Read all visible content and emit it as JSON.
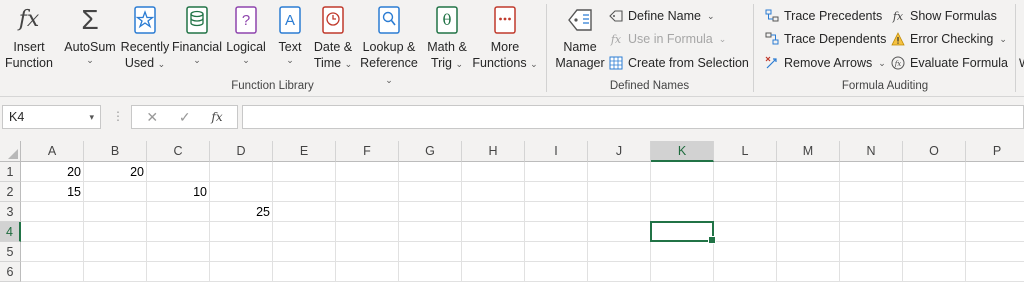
{
  "ribbon": {
    "function_library": {
      "insert_function": {
        "line1": "Insert",
        "line2": "Function",
        "icon": "fx-icon"
      },
      "autosum": {
        "line1": "AutoSum",
        "chev": "⌄",
        "icon": "sigma-icon"
      },
      "recently_used": {
        "line1": "Recently",
        "line2": "Used",
        "chev": "⌄",
        "icon": "star-book-icon"
      },
      "financial": {
        "line1": "Financial",
        "chev": "⌄",
        "icon": "coins-book-icon"
      },
      "logical": {
        "line1": "Logical",
        "chev": "⌄",
        "icon": "question-book-icon"
      },
      "text": {
        "line1": "Text",
        "chev": "⌄",
        "icon": "text-book-icon"
      },
      "date_time": {
        "line1": "Date &",
        "line2": "Time",
        "chev": "⌄",
        "icon": "clock-book-icon"
      },
      "lookup_reference": {
        "line1": "Lookup &",
        "line2": "Reference",
        "chev": "⌄",
        "icon": "magnifier-book-icon"
      },
      "math_trig": {
        "line1": "Math &",
        "line2": "Trig",
        "chev": "⌄",
        "icon": "theta-book-icon"
      },
      "more_functions": {
        "line1": "More",
        "line2": "Functions",
        "chev": "⌄",
        "icon": "dots-book-icon"
      },
      "label": "Function Library"
    },
    "defined_names": {
      "name_manager": {
        "line1": "Name",
        "line2": "Manager",
        "icon": "tag-icon"
      },
      "define_name": {
        "label": "Define Name",
        "chev": "⌄"
      },
      "use_in_formula": {
        "label": "Use in Formula",
        "chev": "⌄"
      },
      "create_from_selection": {
        "label": "Create from Selection"
      },
      "label": "Defined Names"
    },
    "formula_auditing": {
      "trace_precedents": "Trace Precedents",
      "trace_dependents": "Trace Dependents",
      "remove_arrows": {
        "label": "Remove Arrows",
        "chev": "⌄"
      },
      "show_formulas": "Show Formulas",
      "error_checking": {
        "label": "Error Checking",
        "chev": "⌄"
      },
      "evaluate_formula": "Evaluate Formula",
      "label": "Formula Auditing"
    },
    "overflow_letter": "W"
  },
  "formula_bar": {
    "name_box": "K4",
    "name_box_arrow": "▾",
    "dots": "⋮",
    "cancel_glyph": "✕",
    "enter_glyph": "✓",
    "fx_glyph": "fx",
    "formula": ""
  },
  "sheet": {
    "columns": [
      "A",
      "B",
      "C",
      "D",
      "E",
      "F",
      "G",
      "H",
      "I",
      "J",
      "K",
      "L",
      "M",
      "N",
      "O",
      "P"
    ],
    "rows": [
      "1",
      "2",
      "3",
      "4",
      "5",
      "6"
    ],
    "selected_column": "K",
    "selected_row": "4",
    "cells": {
      "A1": "20",
      "B1": "20",
      "A2": "15",
      "C2": "10",
      "D3": "25"
    }
  },
  "colors": {
    "accent": "#217346",
    "ribbon_bg": "#f3f2f1"
  }
}
